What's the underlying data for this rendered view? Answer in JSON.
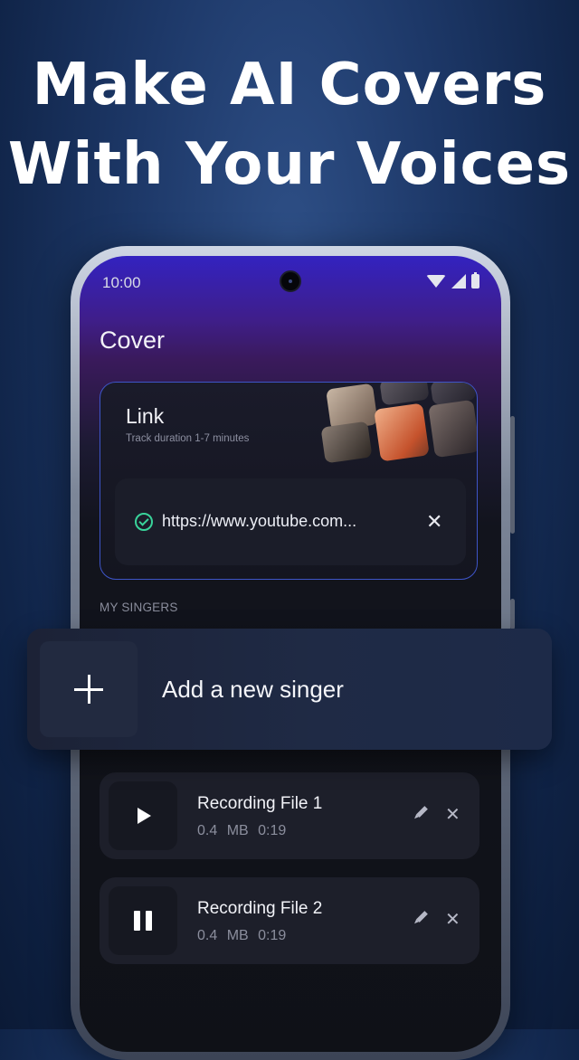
{
  "headline": {
    "line1": "Make AI Covers",
    "line2": "With Your Voices"
  },
  "status_bar": {
    "time": "10:00",
    "icons": [
      "wifi-icon",
      "cellular-icon",
      "battery-icon"
    ]
  },
  "screen": {
    "title": "Cover",
    "link_card": {
      "title": "Link",
      "subtitle": "Track duration 1-7 minutes",
      "url_value": "https://www.youtube.com..."
    },
    "section_label": "MY SINGERS",
    "add_singer_label": "Add a new singer",
    "recordings": [
      {
        "name": "Recording File 1",
        "size": "0.4 MB",
        "duration": "0:19",
        "state": "paused",
        "control_icon": "play-icon"
      },
      {
        "name": "Recording File 2",
        "size": "0.4 MB",
        "duration": "0:19",
        "state": "playing",
        "control_icon": "pause-icon"
      }
    ]
  },
  "colors": {
    "accent_border": "#3e55c8",
    "check": "#39d39a",
    "background": "#1d3868"
  }
}
